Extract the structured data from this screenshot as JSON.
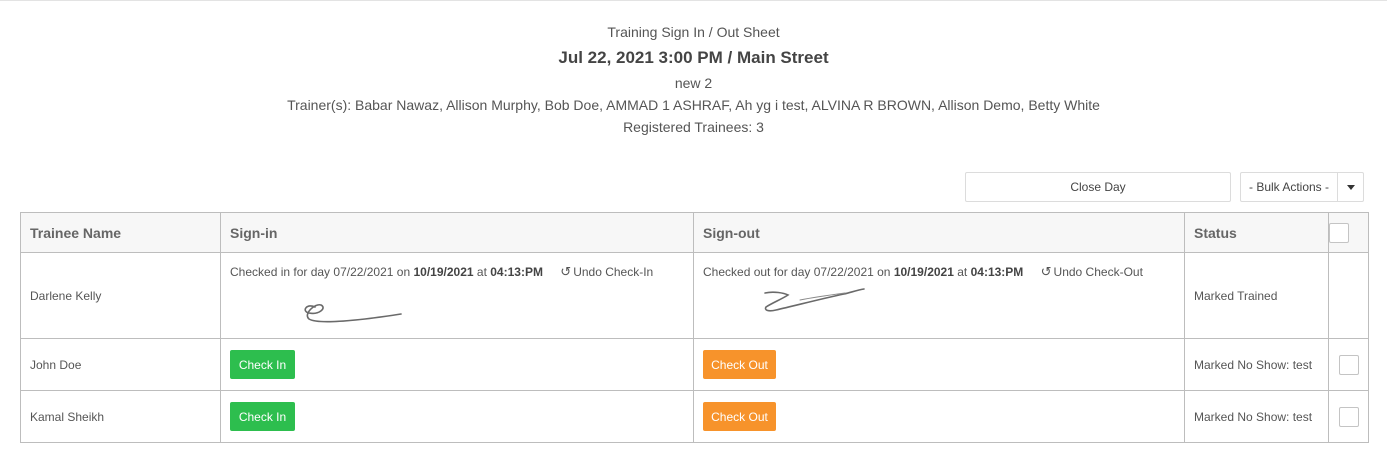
{
  "header": {
    "subtitle": "Training Sign In / Out Sheet",
    "title": "Jul 22, 2021 3:00 PM / Main Street",
    "session_name": "new 2",
    "trainers": "Trainer(s): Babar Nawaz, Allison Murphy, Bob Doe, AMMAD 1 ASHRAF, Ah yg i test, ALVINA R BROWN, Allison Demo, Betty White",
    "registered": "Registered Trainees: 3"
  },
  "toolbar": {
    "close_day_label": "Close Day",
    "bulk_actions_label": "- Bulk Actions -"
  },
  "table": {
    "columns": [
      "Trainee Name",
      "Sign-in",
      "Sign-out",
      "Status"
    ],
    "rows": [
      {
        "name": "Darlene Kelly",
        "signin_text": "Checked in for day 07/22/2021 on",
        "signin_date": "10/19/2021",
        "signin_at": "at",
        "signin_time": "04:13:PM",
        "undo_in_label": "Undo Check-In",
        "signout_text": "Checked out for day 07/22/2021 on",
        "signout_date": "10/19/2021",
        "signout_at": "at",
        "signout_time": "04:13:PM",
        "undo_out_label": "Undo Check-Out",
        "status": "Marked Trained"
      },
      {
        "name": "John Doe",
        "checkin_label": "Check In",
        "checkout_label": "Check Out",
        "status": "Marked No Show: test"
      },
      {
        "name": "Kamal Sheikh",
        "checkin_label": "Check In",
        "checkout_label": "Check Out",
        "status": "Marked No Show: test"
      }
    ]
  },
  "colors": {
    "check_in": "#2dbe4e",
    "check_out": "#f7932b"
  },
  "icons": {
    "undo": "undo-icon",
    "dropdown": "chevron-down-icon"
  }
}
